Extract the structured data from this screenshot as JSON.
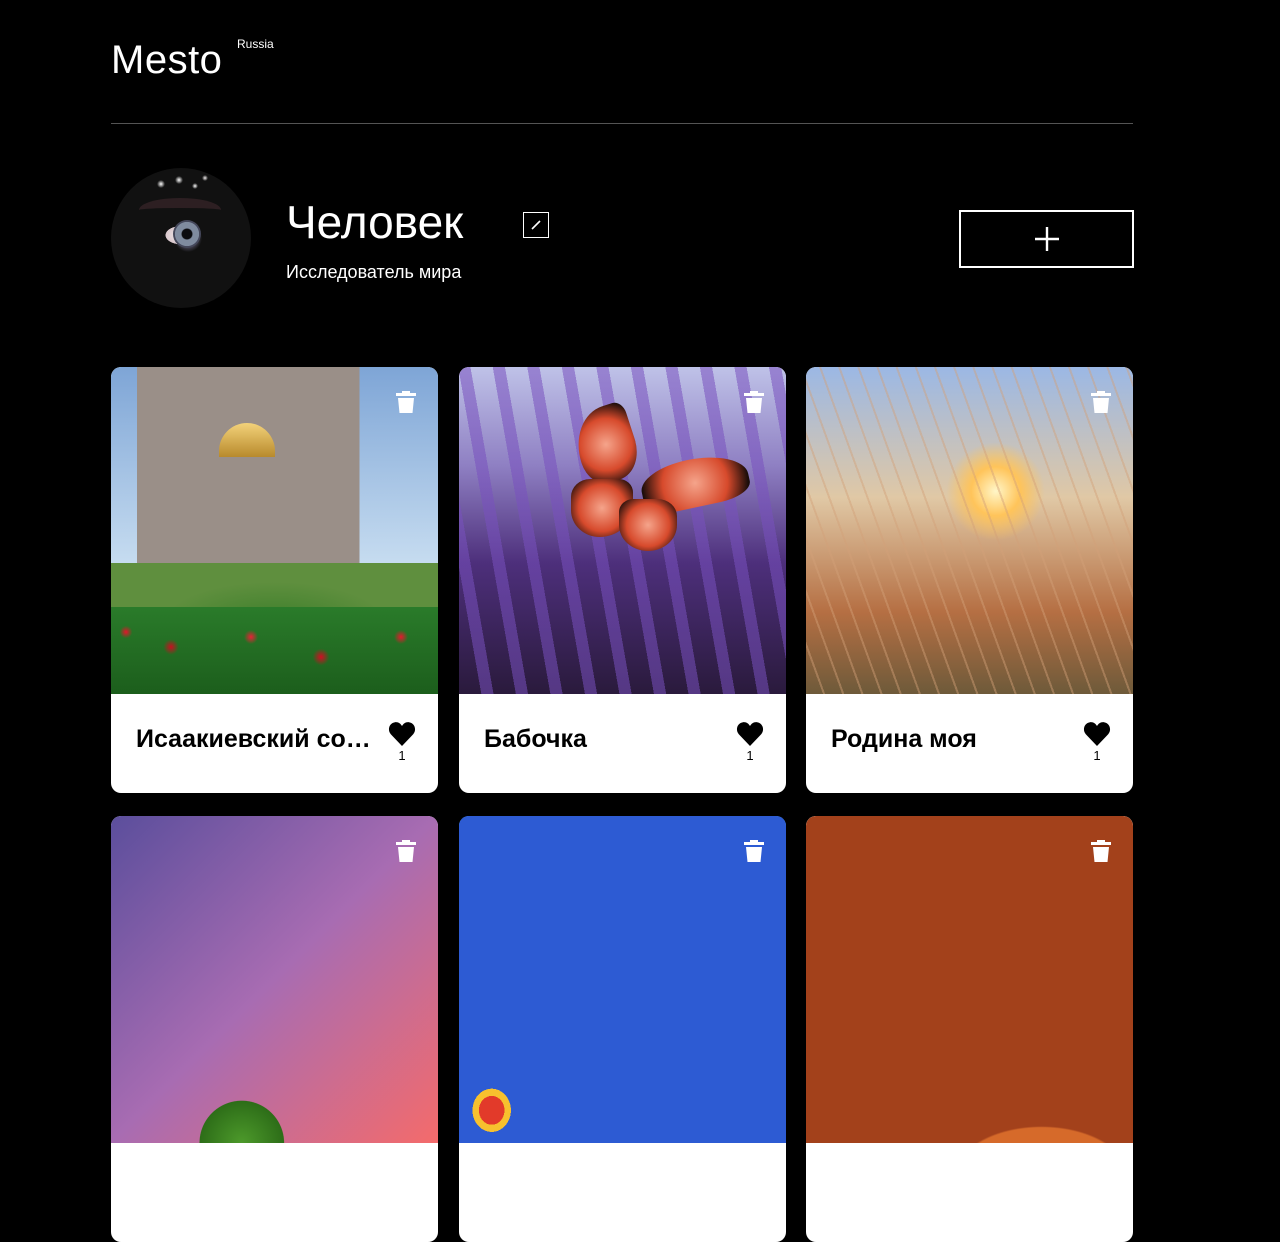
{
  "header": {
    "logo": "Mesto",
    "logo_sup": "Russia"
  },
  "profile": {
    "name": "Человек",
    "about": "Исследователь мира",
    "avatar_icon": "avatar-photo",
    "edit_icon": "pencil-icon",
    "add_icon": "plus-icon"
  },
  "cards": [
    {
      "title": "Исаакиевский собор",
      "likes": "1",
      "image": "saint-isaac-cathedral"
    },
    {
      "title": "Бабочка",
      "likes": "1",
      "image": "butterfly-lavender"
    },
    {
      "title": "Родина моя",
      "likes": "1",
      "image": "grass-sunset"
    },
    {
      "title": "",
      "likes": "",
      "image": "tree-sunset"
    },
    {
      "title": "",
      "likes": "",
      "image": "hot-air-balloons"
    },
    {
      "title": "",
      "likes": "",
      "image": "illustration"
    }
  ],
  "colors": {
    "background": "#000000",
    "card": "#ffffff",
    "divider": "#545454"
  }
}
